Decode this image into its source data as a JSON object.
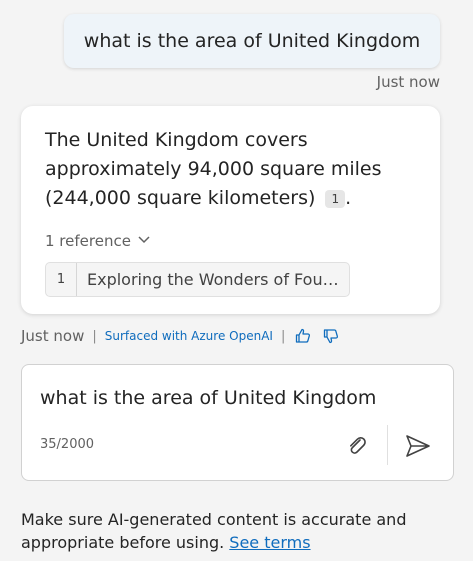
{
  "user_message": {
    "text": "what is the area of United Kingdom",
    "timestamp": "Just now"
  },
  "bot_message": {
    "answer": "The United Kingdom covers approximately 94,000 square miles (244,000 square kilometers)",
    "citation": "1",
    "answer_end": ".",
    "references_toggle": "1 reference",
    "reference": {
      "number": "1",
      "title": "Exploring the Wonders of Fou…"
    },
    "timestamp": "Just now",
    "separator": "|",
    "surfaced_label": "Surfaced with Azure OpenAI"
  },
  "composer": {
    "value": "what is the area of United Kingdom",
    "counter": "35/2000"
  },
  "disclaimer": {
    "text": "Make sure AI-generated content is accurate and appropriate before using. ",
    "link": "See terms"
  },
  "colors": {
    "accent": "#0f6cbd",
    "user_bubble": "#eef4f9",
    "background": "#f4f4f4"
  },
  "icons": [
    "chevron-down-icon",
    "thumbs-up-icon",
    "thumbs-down-icon",
    "paperclip-icon",
    "send-icon"
  ]
}
